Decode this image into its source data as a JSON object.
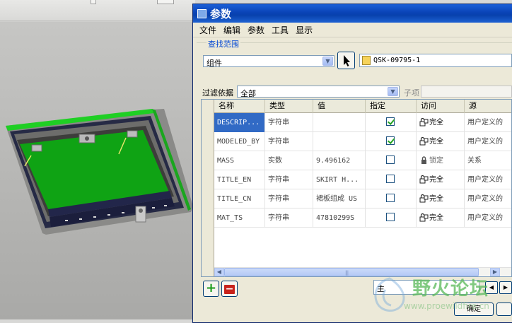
{
  "dialog": {
    "title": "参数",
    "menu": [
      "文件",
      "编辑",
      "参数",
      "工具",
      "显示"
    ],
    "search_scope_label": "查找范围",
    "scope_value": "组件",
    "scope_path": "QSK-09795-1",
    "filter_label": "过滤依据",
    "filter_value": "全部",
    "child_label": "子项"
  },
  "table": {
    "columns": [
      "名称",
      "类型",
      "值",
      "指定",
      "访问",
      "源"
    ],
    "rows": [
      {
        "name": "DESCRIP...",
        "type": "字符串",
        "value": "",
        "designated": true,
        "access": "完全",
        "source": "用户定义的",
        "selected": true
      },
      {
        "name": "MODELED_BY",
        "type": "字符串",
        "value": "",
        "designated": true,
        "access": "完全",
        "source": "用户定义的",
        "selected": false
      },
      {
        "name": "MASS",
        "type": "实数",
        "value": "9.496162",
        "designated": false,
        "access": "锁定",
        "source": "关系",
        "selected": false
      },
      {
        "name": "TITLE_EN",
        "type": "字符串",
        "value": "SKIRT H...",
        "designated": false,
        "access": "完全",
        "source": "用户定义的",
        "selected": false
      },
      {
        "name": "TITLE_CN",
        "type": "字符串",
        "value": "裙板组成 US",
        "designated": false,
        "access": "完全",
        "source": "用户定义的",
        "selected": false
      },
      {
        "name": "MAT_TS",
        "type": "字符串",
        "value": "47810299S",
        "designated": false,
        "access": "完全",
        "source": "用户定义的",
        "selected": false
      }
    ]
  },
  "bottom": {
    "main_label": "主",
    "ok_label": "确定"
  },
  "watermark": {
    "text": "野火论坛",
    "url": "www.proewildfire.cn"
  },
  "colors": {
    "titlebar": "#0a43b6",
    "selection": "#316ac5",
    "pcb_green": "#0fa314",
    "dialog_bg": "#ece9d8"
  }
}
